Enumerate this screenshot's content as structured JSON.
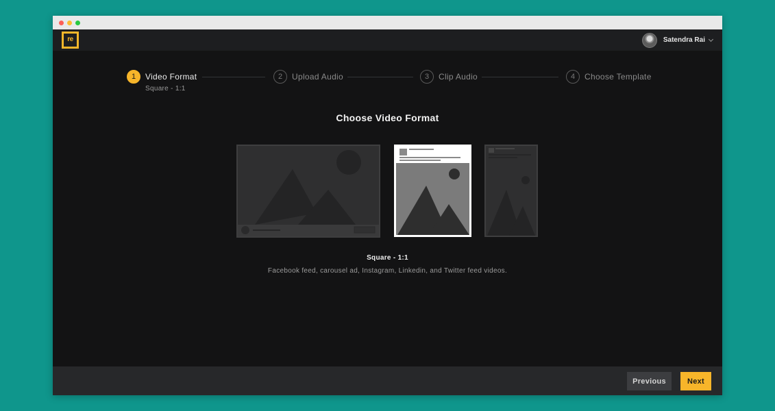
{
  "app": {
    "logo_text": "re",
    "user_name": "Satendra Rai"
  },
  "steps": [
    {
      "number": "1",
      "label": "Video Format",
      "sub": "Square - 1:1",
      "active": true
    },
    {
      "number": "2",
      "label": "Upload Audio",
      "active": false
    },
    {
      "number": "3",
      "label": "Clip Audio",
      "active": false
    },
    {
      "number": "4",
      "label": "Choose Template",
      "active": false
    }
  ],
  "main": {
    "heading": "Choose Video Format",
    "formats": [
      {
        "name": "landscape-format",
        "selected": false
      },
      {
        "name": "square-format",
        "selected": true
      },
      {
        "name": "vertical-format",
        "selected": false
      }
    ],
    "selected_title": "Square - 1:1",
    "selected_description": "Facebook feed, carousel ad, Instagram, Linkedin, and Twitter feed videos."
  },
  "footer": {
    "previous_label": "Previous",
    "next_label": "Next"
  },
  "colors": {
    "accent": "#f7b52a",
    "background": "#131314",
    "outer": "#0f968c"
  }
}
